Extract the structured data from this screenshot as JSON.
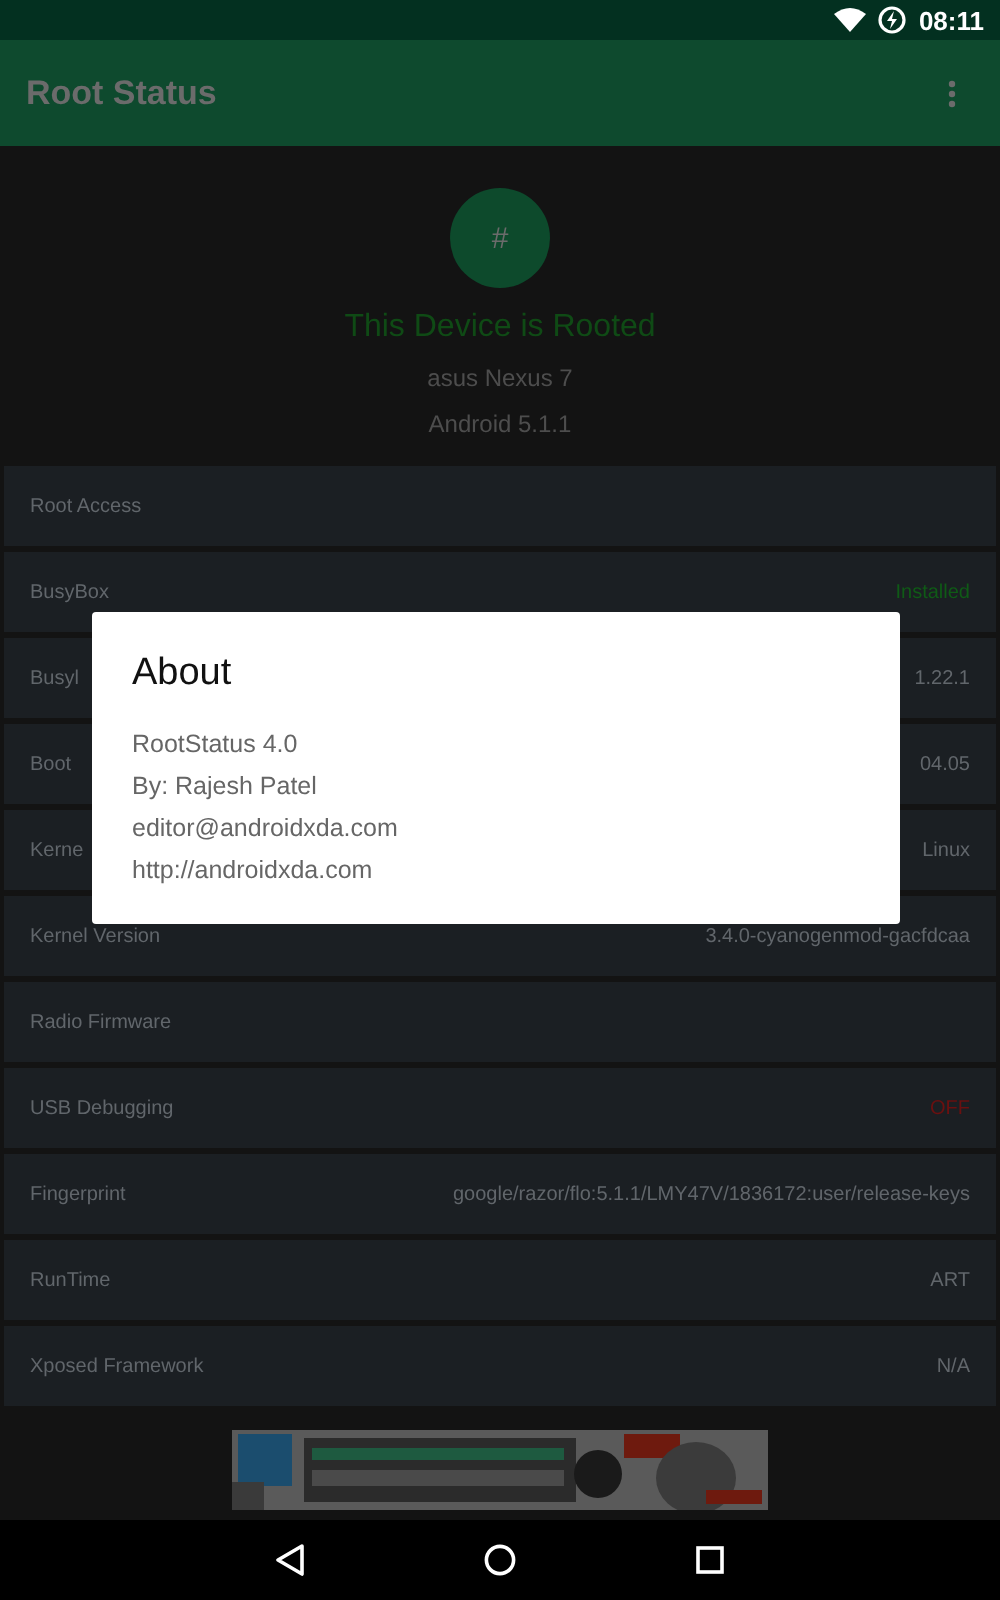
{
  "status_bar": {
    "time": "08:11"
  },
  "app_bar": {
    "title": "Root Status"
  },
  "header": {
    "badge": "#",
    "status": "This Device is Rooted",
    "device": "asus Nexus 7",
    "android": "Android 5.1.1"
  },
  "rows": [
    {
      "label": "Root Access"
    },
    {
      "label": "BusyBox",
      "value": "Installed",
      "kind": "good"
    },
    {
      "label": "Busyl",
      "value": "1.22.1",
      "kind": "plain"
    },
    {
      "label": "Boot",
      "value": "04.05",
      "kind": "plain"
    },
    {
      "label": "Kerne",
      "value": "Linux",
      "kind": "plain"
    },
    {
      "label": "Kernel Version",
      "value": "3.4.0-cyanogenmod-gacfdcaa",
      "kind": "plain"
    },
    {
      "label": "Radio Firmware"
    },
    {
      "label": "USB Debugging",
      "value": "OFF",
      "kind": "bad"
    },
    {
      "label": "Fingerprint",
      "value": "google/razor/flo:5.1.1/LMY47V/1836172:user/release-keys",
      "kind": "plain"
    },
    {
      "label": "RunTime",
      "value": "ART",
      "kind": "plain"
    },
    {
      "label": "Xposed Framework",
      "value": "N/A",
      "kind": "plain"
    }
  ],
  "dialog": {
    "title": "About",
    "lines": [
      "RootStatus 4.0",
      "By: Rajesh Patel",
      "editor@androidxda.com",
      "http://androidxda.com"
    ]
  }
}
